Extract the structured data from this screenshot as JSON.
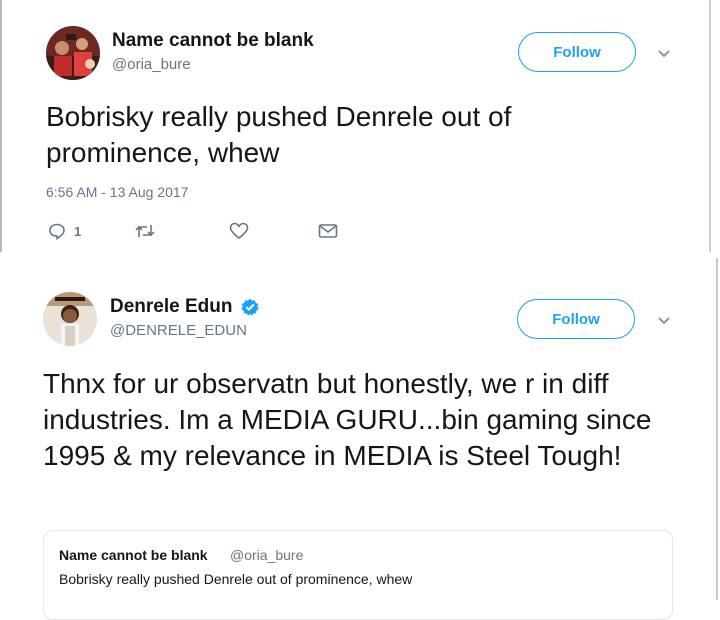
{
  "tweet1": {
    "name": "Name cannot be blank",
    "handle": "@oria_bure",
    "follow_label": "Follow",
    "text": "Bobrisky really pushed Denrele out of prominence, whew",
    "timestamp": "6:56 AM - 13 Aug 2017",
    "actions": {
      "reply_count": "1"
    }
  },
  "tweet2": {
    "name": "Denrele Edun",
    "handle": "@DENRELE_EDUN",
    "follow_label": "Follow",
    "verified": true,
    "text": "Thnx for ur observatn but honestly, we r in diff industries. Im a MEDIA GURU...bin gaming since 1995 & my relevance in MEDIA is Steel Tough!",
    "quoted": {
      "name": "Name cannot be blank",
      "handle": "@oria_bure",
      "text": "Bobrisky really pushed Denrele out of prominence, whew"
    }
  },
  "icons": {
    "reply": "reply-icon",
    "retweet": "retweet-icon",
    "like": "heart-icon",
    "dm": "envelope-icon",
    "verified": "verified-badge-icon",
    "more": "chevron-down-icon"
  },
  "colors": {
    "accent": "#1da1f2",
    "text": "#14171a",
    "secondary": "#657786"
  }
}
